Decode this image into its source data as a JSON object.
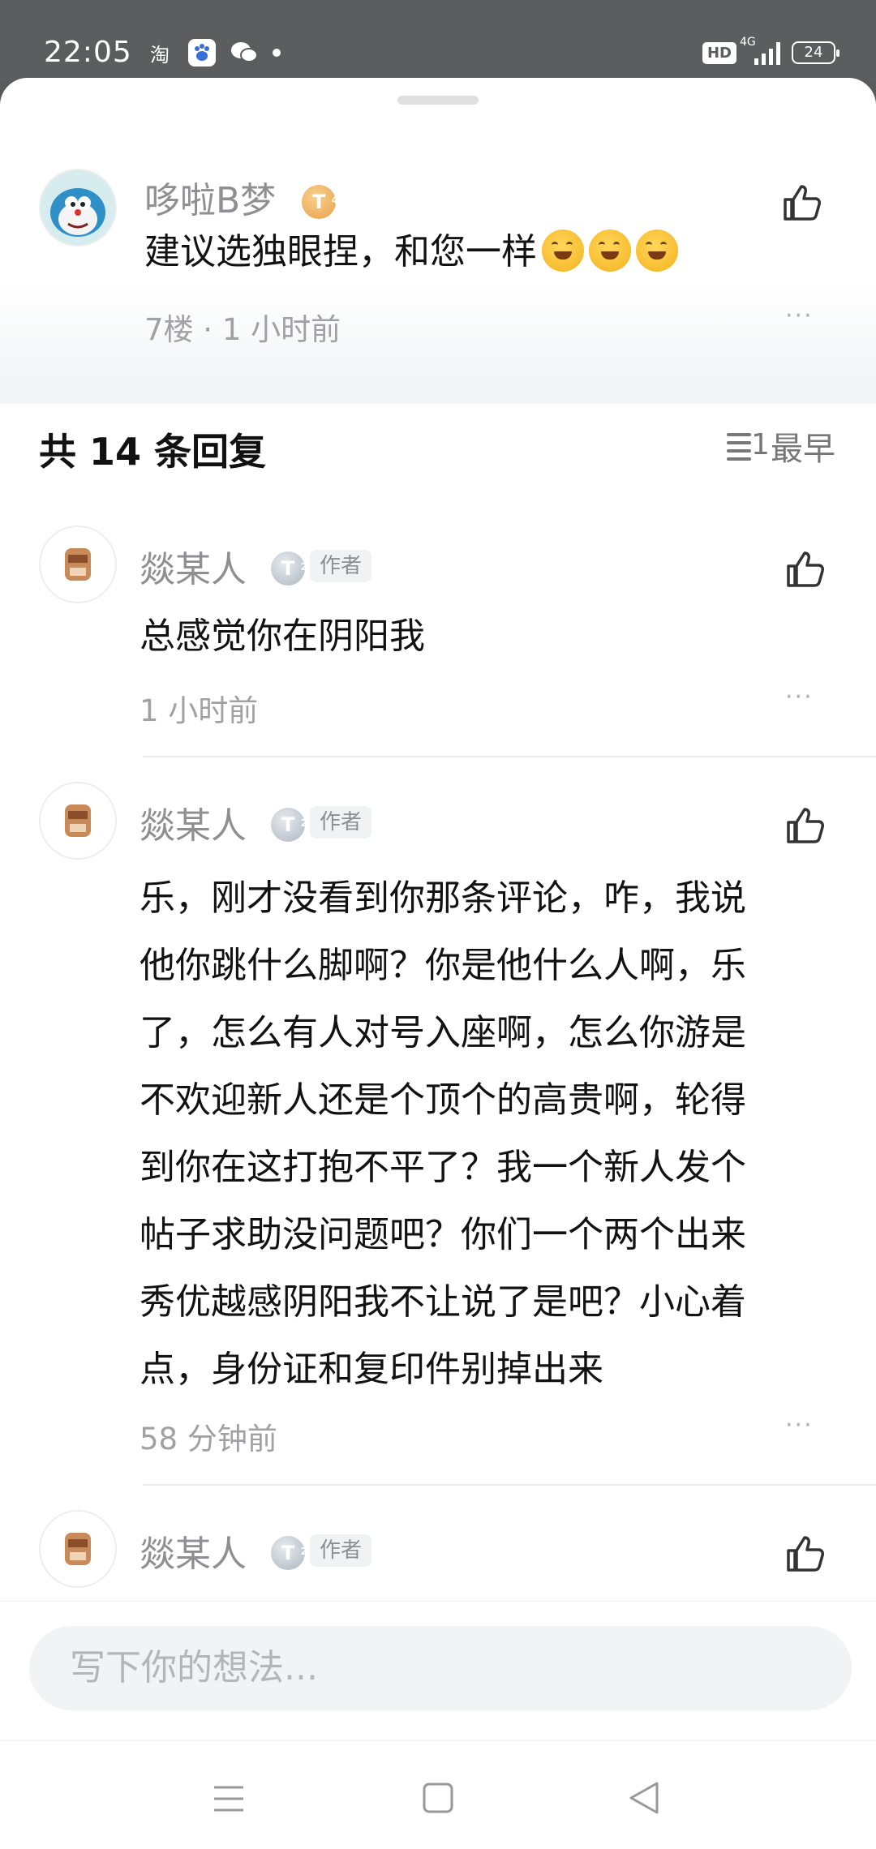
{
  "status_bar": {
    "time": "22:05",
    "apps": [
      "淘",
      "百",
      "微"
    ],
    "hd": "HD",
    "network": "4G",
    "battery": "24"
  },
  "main_comment": {
    "username": "哆啦B梦",
    "badge": "T",
    "badge_level": "4",
    "text": "建议选独眼捏，和您一样",
    "emoji_count": 3,
    "meta": "7楼 · 1 小时前",
    "more": "···"
  },
  "replies_header": {
    "prefix": "共 ",
    "count": "14",
    "suffix": " 条回复",
    "sort_label": "最早",
    "sort_icon_digit": "1"
  },
  "replies": [
    {
      "username": "燚某人",
      "badge": "T",
      "badge_level": "2",
      "author_tag": "作者",
      "text": "总感觉你在阴阳我",
      "meta": "1 小时前",
      "more": "···"
    },
    {
      "username": "燚某人",
      "badge": "T",
      "badge_level": "2",
      "author_tag": "作者",
      "lines": [
        "乐，刚才没看到你那条评论，咋，我说",
        "他你跳什么脚啊？你是他什么人啊，乐",
        "了，怎么有人对号入座啊，怎么你游是",
        "不欢迎新人还是个顶个的高贵啊，轮得",
        "到你在这打抱不平了？我一个新人发个",
        "帖子求助没问题吧？你们一个两个出来",
        "秀优越感阴阳我不让说了是吧？小心着",
        "点，身份证和复印件别掉出来"
      ],
      "meta": "58 分钟前",
      "more": "···"
    },
    {
      "username": "燚某人",
      "badge": "T",
      "badge_level": "2",
      "author_tag": "作者"
    }
  ],
  "input": {
    "placeholder": "写下你的想法..."
  },
  "colors": {
    "username": "#8e8e93",
    "meta": "#a0a0a5",
    "text": "#121212",
    "gold_badge": "#e8a14d",
    "silver_badge": "#aeb6c1"
  },
  "icons": [
    "like-icon",
    "more-icon",
    "sort-icon",
    "menu-icon",
    "home-icon",
    "back-icon"
  ]
}
